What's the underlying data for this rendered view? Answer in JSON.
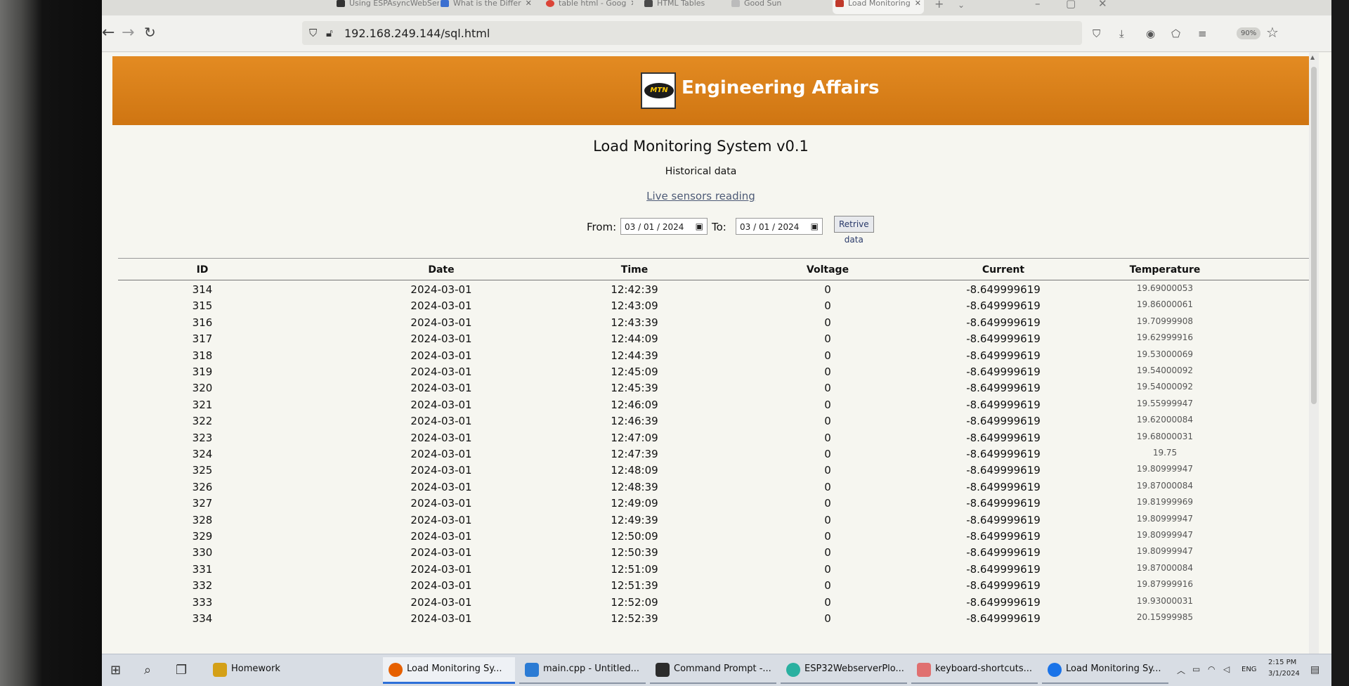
{
  "tabs": [
    {
      "label": "Using ESPAsyncWebServer",
      "icon_color": "#333333",
      "active": false
    },
    {
      "label": "What is the Differ",
      "icon_color": "#3b6fd0",
      "active": false
    },
    {
      "label": "table html - Goog",
      "icon_color": "#db4437",
      "active": false
    },
    {
      "label": "HTML Tables",
      "icon_color": "#4a4a4a",
      "active": false
    },
    {
      "label": "Good Sun",
      "icon_color": "#999999",
      "active": false
    },
    {
      "label": "Load Monitoring",
      "icon_color": "#c0392b",
      "active": true
    }
  ],
  "nav": {
    "back_icon": "←",
    "forward_icon": "→",
    "reload_icon": "↻",
    "url": "192.168.249.144/sql.html",
    "zoom": "90%"
  },
  "banner": {
    "logo_text": "MTN",
    "title": "Engineering Affairs",
    "color": "#e08420"
  },
  "page": {
    "title": "Load Monitoring System v0.1",
    "subtitle": "Historical data",
    "live_link": "Live sensors reading"
  },
  "filter": {
    "from_label": "From:",
    "from_value": "03 / 01 / 2024",
    "to_label": "To:",
    "to_value": "03 / 01 / 2024",
    "button_label": "Retrive data"
  },
  "table": {
    "headers": [
      "ID",
      "Date",
      "Time",
      "Voltage",
      "Current",
      "Temperature"
    ],
    "rows": [
      [
        "314",
        "2024-03-01",
        "12:42:39",
        "0",
        "-8.649999619",
        "19.69000053"
      ],
      [
        "315",
        "2024-03-01",
        "12:43:09",
        "0",
        "-8.649999619",
        "19.86000061"
      ],
      [
        "316",
        "2024-03-01",
        "12:43:39",
        "0",
        "-8.649999619",
        "19.70999908"
      ],
      [
        "317",
        "2024-03-01",
        "12:44:09",
        "0",
        "-8.649999619",
        "19.62999916"
      ],
      [
        "318",
        "2024-03-01",
        "12:44:39",
        "0",
        "-8.649999619",
        "19.53000069"
      ],
      [
        "319",
        "2024-03-01",
        "12:45:09",
        "0",
        "-8.649999619",
        "19.54000092"
      ],
      [
        "320",
        "2024-03-01",
        "12:45:39",
        "0",
        "-8.649999619",
        "19.54000092"
      ],
      [
        "321",
        "2024-03-01",
        "12:46:09",
        "0",
        "-8.649999619",
        "19.55999947"
      ],
      [
        "322",
        "2024-03-01",
        "12:46:39",
        "0",
        "-8.649999619",
        "19.62000084"
      ],
      [
        "323",
        "2024-03-01",
        "12:47:09",
        "0",
        "-8.649999619",
        "19.68000031"
      ],
      [
        "324",
        "2024-03-01",
        "12:47:39",
        "0",
        "-8.649999619",
        "19.75"
      ],
      [
        "325",
        "2024-03-01",
        "12:48:09",
        "0",
        "-8.649999619",
        "19.80999947"
      ],
      [
        "326",
        "2024-03-01",
        "12:48:39",
        "0",
        "-8.649999619",
        "19.87000084"
      ],
      [
        "327",
        "2024-03-01",
        "12:49:09",
        "0",
        "-8.649999619",
        "19.81999969"
      ],
      [
        "328",
        "2024-03-01",
        "12:49:39",
        "0",
        "-8.649999619",
        "19.80999947"
      ],
      [
        "329",
        "2024-03-01",
        "12:50:09",
        "0",
        "-8.649999619",
        "19.80999947"
      ],
      [
        "330",
        "2024-03-01",
        "12:50:39",
        "0",
        "-8.649999619",
        "19.80999947"
      ],
      [
        "331",
        "2024-03-01",
        "12:51:09",
        "0",
        "-8.649999619",
        "19.87000084"
      ],
      [
        "332",
        "2024-03-01",
        "12:51:39",
        "0",
        "-8.649999619",
        "19.87999916"
      ],
      [
        "333",
        "2024-03-01",
        "12:52:09",
        "0",
        "-8.649999619",
        "19.93000031"
      ],
      [
        "334",
        "2024-03-01",
        "12:52:39",
        "0",
        "-8.649999619",
        "20.15999985"
      ]
    ]
  },
  "taskbar": {
    "items": [
      {
        "label": "Homework",
        "icon_color": "#d4a017",
        "state": "normal"
      },
      {
        "label": "Load Monitoring Sy...",
        "icon_color": "#e66000",
        "state": "active"
      },
      {
        "label": "main.cpp - Untitled...",
        "icon_color": "#2b7bd4",
        "state": "open"
      },
      {
        "label": "Command Prompt -...",
        "icon_color": "#2c2c2c",
        "state": "open"
      },
      {
        "label": "ESP32WebserverPlo...",
        "icon_color": "#2ab0a0",
        "state": "open"
      },
      {
        "label": "keyboard-shortcuts...",
        "icon_color": "#e07070",
        "state": "open"
      },
      {
        "label": "Load Monitoring Sy...",
        "icon_color": "#1a73e8",
        "state": "open"
      }
    ],
    "tray_lang": "ENG",
    "tray_time": "2:15 PM",
    "tray_date": "3/1/2024"
  }
}
